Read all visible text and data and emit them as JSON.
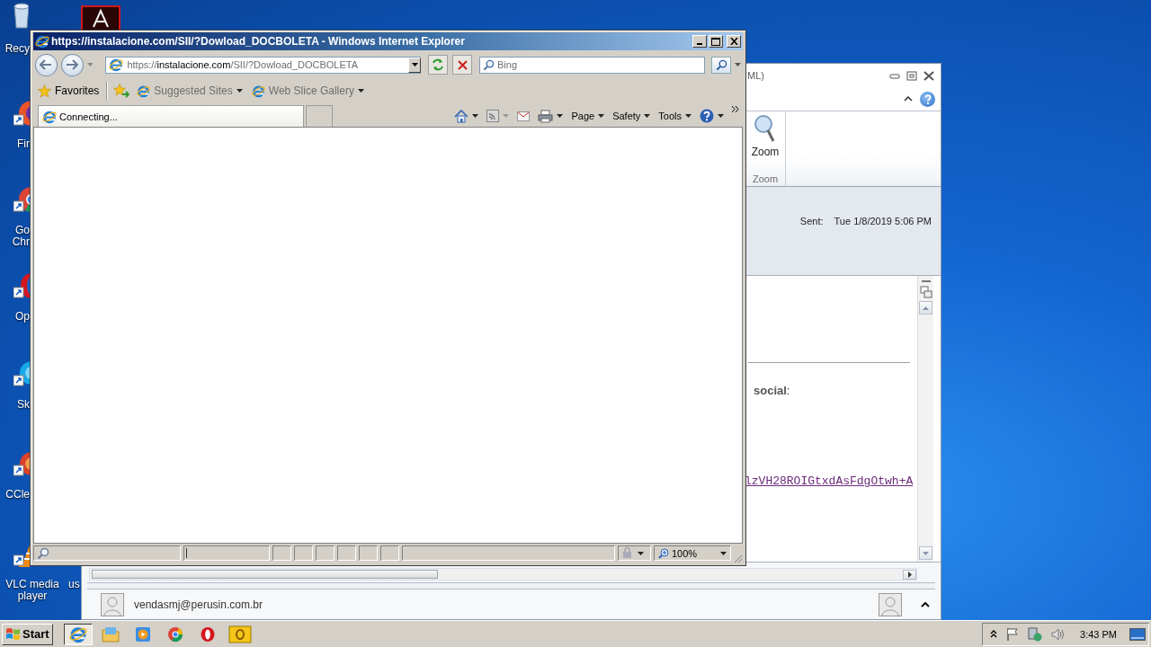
{
  "desktop_icons": [
    {
      "kind": "recycle-bin",
      "lines": [
        "Recy"
      ]
    },
    {
      "kind": "acrobat"
    },
    {
      "kind": "firefox",
      "lines": [
        "Fir"
      ]
    },
    {
      "kind": "chrome",
      "lines": [
        "Go",
        "Chr"
      ]
    },
    {
      "kind": "opera",
      "lines": [
        "Op"
      ]
    },
    {
      "kind": "skype",
      "lines": [
        "Sk"
      ]
    },
    {
      "kind": "ccleaner",
      "lines": [
        "CCle"
      ]
    },
    {
      "kind": "vlc",
      "lines": [
        "VLC media",
        "player"
      ]
    },
    {
      "kind": "hidden",
      "lines": [
        "us"
      ]
    }
  ],
  "outlook": {
    "title": "ML)",
    "ribbon_button": "Zoom",
    "ribbon_group": "Zoom",
    "sent_label": "Sent:",
    "sent_value": "Tue 1/8/2019 5:06 PM",
    "body_text": "**social**:",
    "link": "lzVH28ROIGtxdAsFdgOtwh+A",
    "sender": "vendasmj@perusin.com.br"
  },
  "browser": {
    "title": "https://instalacione.com/SII/?Dowload_DOCBOLETA - Windows Internet Explorer",
    "address": {
      "scheme": "https://",
      "domain": "instalacione.com",
      "path": "/SII/?Dowload_DOCBOLETA"
    },
    "search": {
      "placeholder": "Bing"
    },
    "favorites_label": "Favorites",
    "favorites": [
      {
        "label": "Suggested Sites"
      },
      {
        "label": "Web Slice Gallery"
      }
    ],
    "tab": {
      "label": "Connecting..."
    },
    "progress": {
      "level": 0.01
    },
    "commands": [
      {
        "label": "Page"
      },
      {
        "label": "Safety"
      },
      {
        "label": "Tools"
      }
    ],
    "zoom": "100%"
  },
  "taskbar": {
    "start": "Start",
    "apps": [
      {
        "kind": "ie",
        "selected": true
      },
      {
        "kind": "explorer",
        "selected": false
      },
      {
        "kind": "media-player",
        "selected": false
      },
      {
        "kind": "chrome",
        "selected": false
      },
      {
        "kind": "opera",
        "selected": false
      },
      {
        "kind": "outlook",
        "selected": false
      }
    ],
    "clock": "3:43 PM"
  }
}
